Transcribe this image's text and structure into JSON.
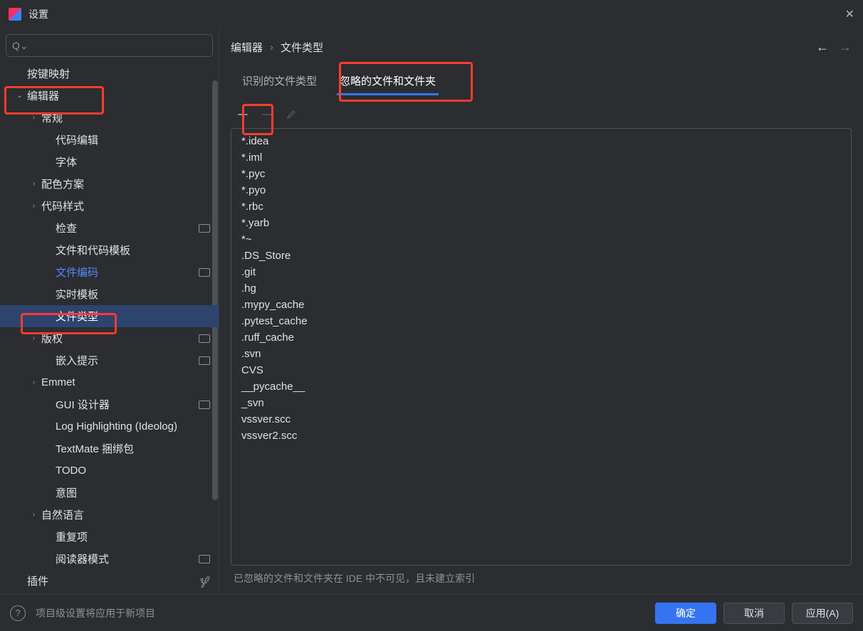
{
  "window": {
    "title": "设置"
  },
  "search": {
    "placeholder": ""
  },
  "sidebar": {
    "items": [
      {
        "label": "按键映射",
        "depth": 1,
        "chevron": ""
      },
      {
        "label": "编辑器",
        "depth": 1,
        "chevron": "down"
      },
      {
        "label": "常规",
        "depth": 2,
        "chevron": "right"
      },
      {
        "label": "代码编辑",
        "depth": 3,
        "chevron": ""
      },
      {
        "label": "字体",
        "depth": 3,
        "chevron": ""
      },
      {
        "label": "配色方案",
        "depth": 2,
        "chevron": "right"
      },
      {
        "label": "代码样式",
        "depth": 2,
        "chevron": "right"
      },
      {
        "label": "检查",
        "depth": 3,
        "chevron": "",
        "badge": true
      },
      {
        "label": "文件和代码模板",
        "depth": 3,
        "chevron": ""
      },
      {
        "label": "文件编码",
        "depth": 3,
        "chevron": "",
        "badge": true,
        "linkish": true
      },
      {
        "label": "实时模板",
        "depth": 3,
        "chevron": ""
      },
      {
        "label": "文件类型",
        "depth": 3,
        "chevron": "",
        "selected": true
      },
      {
        "label": "版权",
        "depth": 2,
        "chevron": "right",
        "badge": true
      },
      {
        "label": "嵌入提示",
        "depth": 3,
        "chevron": "",
        "badge": true
      },
      {
        "label": "Emmet",
        "depth": 2,
        "chevron": "right"
      },
      {
        "label": "GUI 设计器",
        "depth": 3,
        "chevron": "",
        "badge": true
      },
      {
        "label": "Log Highlighting (Ideolog)",
        "depth": 3,
        "chevron": ""
      },
      {
        "label": "TextMate 捆绑包",
        "depth": 3,
        "chevron": ""
      },
      {
        "label": "TODO",
        "depth": 3,
        "chevron": ""
      },
      {
        "label": "意图",
        "depth": 3,
        "chevron": ""
      },
      {
        "label": "自然语言",
        "depth": 2,
        "chevron": "right"
      },
      {
        "label": "重复项",
        "depth": 3,
        "chevron": ""
      },
      {
        "label": "阅读器模式",
        "depth": 3,
        "chevron": "",
        "badge": true
      },
      {
        "label": "插件",
        "depth": 1,
        "chevron": "",
        "lang": true
      }
    ]
  },
  "breadcrumb": {
    "part1": "编辑器",
    "part2": "文件类型"
  },
  "tabs": {
    "recognized": "识别的文件类型",
    "ignored": "忽略的文件和文件夹"
  },
  "ignore_list": [
    "*.idea",
    "*.iml",
    "*.pyc",
    "*.pyo",
    "*.rbc",
    "*.yarb",
    "*~",
    ".DS_Store",
    ".git",
    ".hg",
    ".mypy_cache",
    ".pytest_cache",
    ".ruff_cache",
    ".svn",
    "CVS",
    "__pycache__",
    "_svn",
    "vssver.scc",
    "vssver2.scc"
  ],
  "hint": "已忽略的文件和文件夹在 IDE 中不可见，且未建立索引",
  "footer": {
    "note": "项目级设置将应用于新项目",
    "ok": "确定",
    "cancel": "取消",
    "apply": "应用(A)"
  }
}
